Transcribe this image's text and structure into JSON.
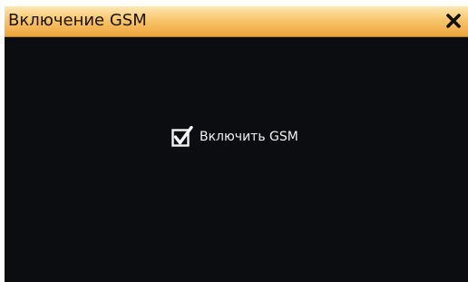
{
  "window": {
    "title": "Включение GSM",
    "close_icon": "close-icon"
  },
  "main": {
    "checkbox": {
      "label": "Включить GSM",
      "checked": true,
      "icon": "checkmark-icon"
    }
  },
  "colors": {
    "titlebar_top": "#fde7b5",
    "titlebar_bottom": "#eda53b",
    "background": "#0c0d10",
    "text": "#f2f2f2"
  }
}
